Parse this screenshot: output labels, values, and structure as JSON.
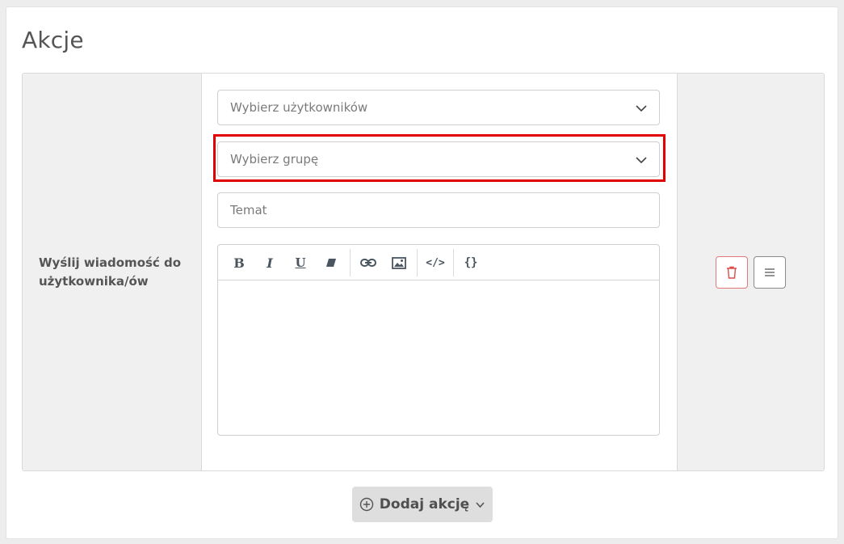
{
  "section": {
    "title": "Akcje"
  },
  "action": {
    "label": "Wyślij wiadomość do użytkownika/ów",
    "users_select": {
      "placeholder": "Wybierz użytkowników"
    },
    "group_select": {
      "placeholder": "Wybierz grupę"
    },
    "subject_input": {
      "placeholder": "Temat",
      "value": ""
    },
    "editor": {
      "toolbar": [
        {
          "name": "bold-icon",
          "glyph": "B"
        },
        {
          "name": "italic-icon",
          "glyph": "I"
        },
        {
          "name": "underline-icon",
          "glyph": "U"
        },
        {
          "name": "eraser-icon",
          "glyph": ""
        },
        {
          "name": "link-icon",
          "glyph": ""
        },
        {
          "name": "image-icon",
          "glyph": ""
        },
        {
          "name": "code-icon",
          "glyph": "</>"
        },
        {
          "name": "variables-icon",
          "glyph": "{}"
        }
      ],
      "content": ""
    },
    "buttons": {
      "delete": "trash-icon",
      "drag": "menu-icon"
    }
  },
  "add_action": {
    "label": "Dodaj akcję"
  },
  "colors": {
    "highlight": "#e00000",
    "delete_border": "#e07a7a"
  }
}
